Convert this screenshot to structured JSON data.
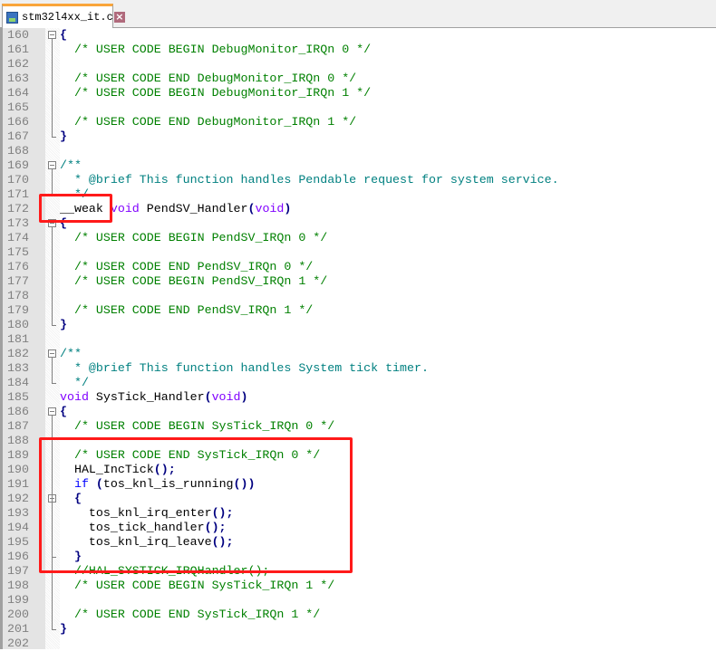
{
  "tab": {
    "title": "stm32l4xx_it.c",
    "icon": "save-icon",
    "close_icon": "close-icon"
  },
  "colors": {
    "comment": "#008000",
    "doc_comment": "#008080",
    "keyword": "#0000ff",
    "type": "#8000ff",
    "operator": "#000080",
    "highlight_box": "#ff1a1a",
    "tab_accent": "#f9a53a"
  },
  "lines": [
    {
      "n": "160",
      "fold": "open",
      "s": [
        [
          "o",
          "{"
        ]
      ]
    },
    {
      "n": "161",
      "s": [
        [
          "p",
          "  "
        ],
        [
          "c",
          "/* USER CODE BEGIN DebugMonitor_IRQn 0 */"
        ]
      ]
    },
    {
      "n": "162",
      "s": []
    },
    {
      "n": "163",
      "s": [
        [
          "p",
          "  "
        ],
        [
          "c",
          "/* USER CODE END DebugMonitor_IRQn 0 */"
        ]
      ]
    },
    {
      "n": "164",
      "s": [
        [
          "p",
          "  "
        ],
        [
          "c",
          "/* USER CODE BEGIN DebugMonitor_IRQn 1 */"
        ]
      ]
    },
    {
      "n": "165",
      "s": []
    },
    {
      "n": "166",
      "s": [
        [
          "p",
          "  "
        ],
        [
          "c",
          "/* USER CODE END DebugMonitor_IRQn 1 */"
        ]
      ]
    },
    {
      "n": "167",
      "fold": "end",
      "s": [
        [
          "o",
          "}"
        ]
      ]
    },
    {
      "n": "168",
      "s": []
    },
    {
      "n": "169",
      "fold": "open",
      "s": [
        [
          "d",
          "/**"
        ]
      ]
    },
    {
      "n": "170",
      "s": [
        [
          "d",
          "  * @brief This function handles Pendable request for system service."
        ]
      ]
    },
    {
      "n": "171",
      "fold": "end",
      "s": [
        [
          "d",
          "  */"
        ]
      ]
    },
    {
      "n": "172",
      "s": [
        [
          "p",
          "__weak "
        ],
        [
          "t",
          "void"
        ],
        [
          "p",
          " PendSV_Handler"
        ],
        [
          "o",
          "("
        ],
        [
          "t",
          "void"
        ],
        [
          "o",
          ")"
        ]
      ]
    },
    {
      "n": "173",
      "fold": "open",
      "s": [
        [
          "o",
          "{"
        ]
      ]
    },
    {
      "n": "174",
      "s": [
        [
          "p",
          "  "
        ],
        [
          "c",
          "/* USER CODE BEGIN PendSV_IRQn 0 */"
        ]
      ]
    },
    {
      "n": "175",
      "s": []
    },
    {
      "n": "176",
      "s": [
        [
          "p",
          "  "
        ],
        [
          "c",
          "/* USER CODE END PendSV_IRQn 0 */"
        ]
      ]
    },
    {
      "n": "177",
      "s": [
        [
          "p",
          "  "
        ],
        [
          "c",
          "/* USER CODE BEGIN PendSV_IRQn 1 */"
        ]
      ]
    },
    {
      "n": "178",
      "s": []
    },
    {
      "n": "179",
      "s": [
        [
          "p",
          "  "
        ],
        [
          "c",
          "/* USER CODE END PendSV_IRQn 1 */"
        ]
      ]
    },
    {
      "n": "180",
      "fold": "end",
      "s": [
        [
          "o",
          "}"
        ]
      ]
    },
    {
      "n": "181",
      "s": []
    },
    {
      "n": "182",
      "fold": "open",
      "s": [
        [
          "d",
          "/**"
        ]
      ]
    },
    {
      "n": "183",
      "s": [
        [
          "d",
          "  * @brief This function handles System tick timer."
        ]
      ]
    },
    {
      "n": "184",
      "fold": "end",
      "s": [
        [
          "d",
          "  */"
        ]
      ]
    },
    {
      "n": "185",
      "s": [
        [
          "t",
          "void"
        ],
        [
          "p",
          " SysTick_Handler"
        ],
        [
          "o",
          "("
        ],
        [
          "t",
          "void"
        ],
        [
          "o",
          ")"
        ]
      ]
    },
    {
      "n": "186",
      "fold": "open",
      "s": [
        [
          "o",
          "{"
        ]
      ]
    },
    {
      "n": "187",
      "s": [
        [
          "p",
          "  "
        ],
        [
          "c",
          "/* USER CODE BEGIN SysTick_IRQn 0 */"
        ]
      ]
    },
    {
      "n": "188",
      "s": []
    },
    {
      "n": "189",
      "s": [
        [
          "p",
          "  "
        ],
        [
          "c",
          "/* USER CODE END SysTick_IRQn 0 */"
        ]
      ]
    },
    {
      "n": "190",
      "s": [
        [
          "p",
          "  HAL_IncTick"
        ],
        [
          "o",
          "();"
        ]
      ]
    },
    {
      "n": "191",
      "s": [
        [
          "p",
          "  "
        ],
        [
          "k",
          "if"
        ],
        [
          "p",
          " "
        ],
        [
          "o",
          "("
        ],
        [
          "p",
          "tos_knl_is_running"
        ],
        [
          "o",
          "())"
        ]
      ]
    },
    {
      "n": "192",
      "fold": "open",
      "s": [
        [
          "p",
          "  "
        ],
        [
          "o",
          "{"
        ]
      ]
    },
    {
      "n": "193",
      "s": [
        [
          "p",
          "    tos_knl_irq_enter"
        ],
        [
          "o",
          "();"
        ]
      ]
    },
    {
      "n": "194",
      "s": [
        [
          "p",
          "    tos_tick_handler"
        ],
        [
          "o",
          "();"
        ]
      ]
    },
    {
      "n": "195",
      "s": [
        [
          "p",
          "    tos_knl_irq_leave"
        ],
        [
          "o",
          "();"
        ]
      ]
    },
    {
      "n": "196",
      "fold": "mid",
      "s": [
        [
          "p",
          "  "
        ],
        [
          "o",
          "}"
        ]
      ]
    },
    {
      "n": "197",
      "s": [
        [
          "p",
          "  "
        ],
        [
          "c",
          "//HAL_SYSTICK_IRQHandler();"
        ]
      ]
    },
    {
      "n": "198",
      "s": [
        [
          "p",
          "  "
        ],
        [
          "c",
          "/* USER CODE BEGIN SysTick_IRQn 1 */"
        ]
      ]
    },
    {
      "n": "199",
      "s": []
    },
    {
      "n": "200",
      "s": [
        [
          "p",
          "  "
        ],
        [
          "c",
          "/* USER CODE END SysTick_IRQn 1 */"
        ]
      ]
    },
    {
      "n": "201",
      "fold": "end",
      "s": [
        [
          "o",
          "}"
        ]
      ]
    },
    {
      "n": "202",
      "s": []
    }
  ]
}
